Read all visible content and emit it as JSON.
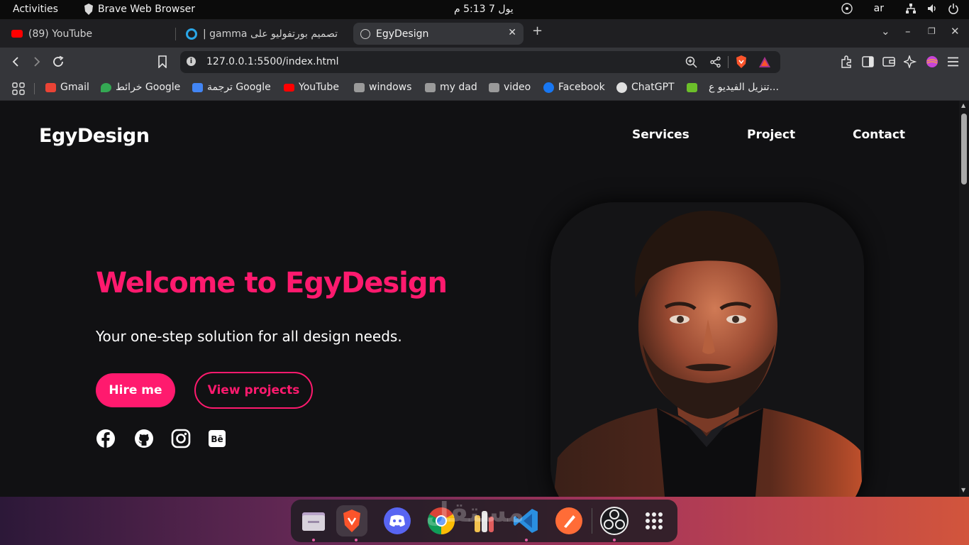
{
  "system": {
    "activities": "Activities",
    "app_name": "Brave Web Browser",
    "clock": "يول 7  5:13 م",
    "language": "ar"
  },
  "tabs": [
    {
      "label": "(89) YouTube",
      "active": false
    },
    {
      "label": "تصميم بورتفوليو على gamma |",
      "active": false
    },
    {
      "label": "EgyDesign",
      "active": true
    }
  ],
  "toolbar": {
    "url": "127.0.0.1:5500/index.html"
  },
  "bookmarks": [
    {
      "label": "Gmail",
      "color": "#ea4335"
    },
    {
      "label": "خرائط Google",
      "color": "#34a853"
    },
    {
      "label": "ترجمة Google",
      "color": "#4285f4"
    },
    {
      "label": "YouTube",
      "color": "#ff0000"
    },
    {
      "label": "windows",
      "color": "#9a9a9a"
    },
    {
      "label": "my dad",
      "color": "#9a9a9a"
    },
    {
      "label": "video",
      "color": "#9a9a9a"
    },
    {
      "label": "Facebook",
      "color": "#1877f2"
    },
    {
      "label": "ChatGPT",
      "color": "#e0e0e0"
    },
    {
      "label": "تنزيل الفيديو ع...",
      "color": "#6cbf2a"
    }
  ],
  "site": {
    "logo": "EgyDesign",
    "nav": [
      "Services",
      "Project",
      "Contact"
    ],
    "hero_title": "Welcome to EgyDesign",
    "hero_subtitle": "Your one-step solution for all design needs.",
    "hire_label": "Hire me",
    "view_label": "View projects",
    "accent": "#ff1a6e",
    "social_icons": [
      "facebook-icon",
      "github-icon",
      "instagram-icon",
      "behance-icon"
    ]
  },
  "dock": {
    "apps": [
      "files-icon",
      "brave-icon",
      "discord-icon",
      "chrome-icon",
      "bottles-icon",
      "vscode-icon",
      "postman-icon",
      "obs-icon",
      "app-grid-icon"
    ],
    "watermark": "مستقل"
  }
}
